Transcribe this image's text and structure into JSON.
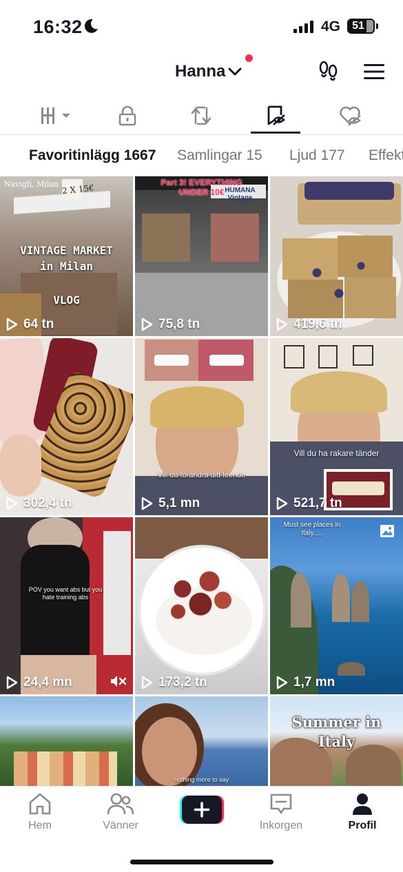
{
  "status_bar": {
    "time": "16:32",
    "network": "4G",
    "battery": "51"
  },
  "header": {
    "username": "Hanna"
  },
  "icon_tabs": [
    "grid-icon",
    "lock-icon",
    "repost-icon",
    "favorites-icon",
    "liked-icon"
  ],
  "sub_tabs": [
    {
      "label": "Favoritinlägg 1667",
      "active": true
    },
    {
      "label": "Samlingar 15",
      "active": false
    },
    {
      "label": "Ljud 177",
      "active": false
    },
    {
      "label": "Effekter",
      "active": false
    }
  ],
  "videos": [
    {
      "views": "64 tn",
      "overlay_top": "Navigli, Milan",
      "overlay_sign": "2 X 15€",
      "overlay_main": "VINTAGE MARKET\nin Milan",
      "overlay_sub": "VLOG"
    },
    {
      "views": "75,8 tn",
      "overlay_main": "Part 3! EVERYTHING\nUNDER 10€",
      "store_sign": "HUMANA Vintage"
    },
    {
      "views": "419,6 tn"
    },
    {
      "views": "302,4 tn"
    },
    {
      "views": "5,1 mn",
      "caption": "Vill du förändra ditt leende"
    },
    {
      "views": "521,7 tn",
      "caption": "Vill du ha rakare tänder"
    },
    {
      "views": "24,4 mn",
      "caption": "POV you want abs but you\nhate training abs",
      "muted": true
    },
    {
      "views": "173,2 tn"
    },
    {
      "views": "1,7 mn",
      "caption": "Must see places in\nItaly.....",
      "photo_icon": true
    },
    {
      "views": ""
    },
    {
      "views": "",
      "caption": "nothing more to say"
    },
    {
      "views": "",
      "overlay_main": "Summer in\nItaly"
    }
  ],
  "bottom_nav": {
    "home": "Hem",
    "friends": "Vänner",
    "inbox": "Inkorgen",
    "profile": "Profil"
  },
  "colors": {
    "accent_red": "#fe2c55",
    "accent_cyan": "#25f4ee",
    "text": "#161823",
    "muted": "#8a8b91"
  }
}
